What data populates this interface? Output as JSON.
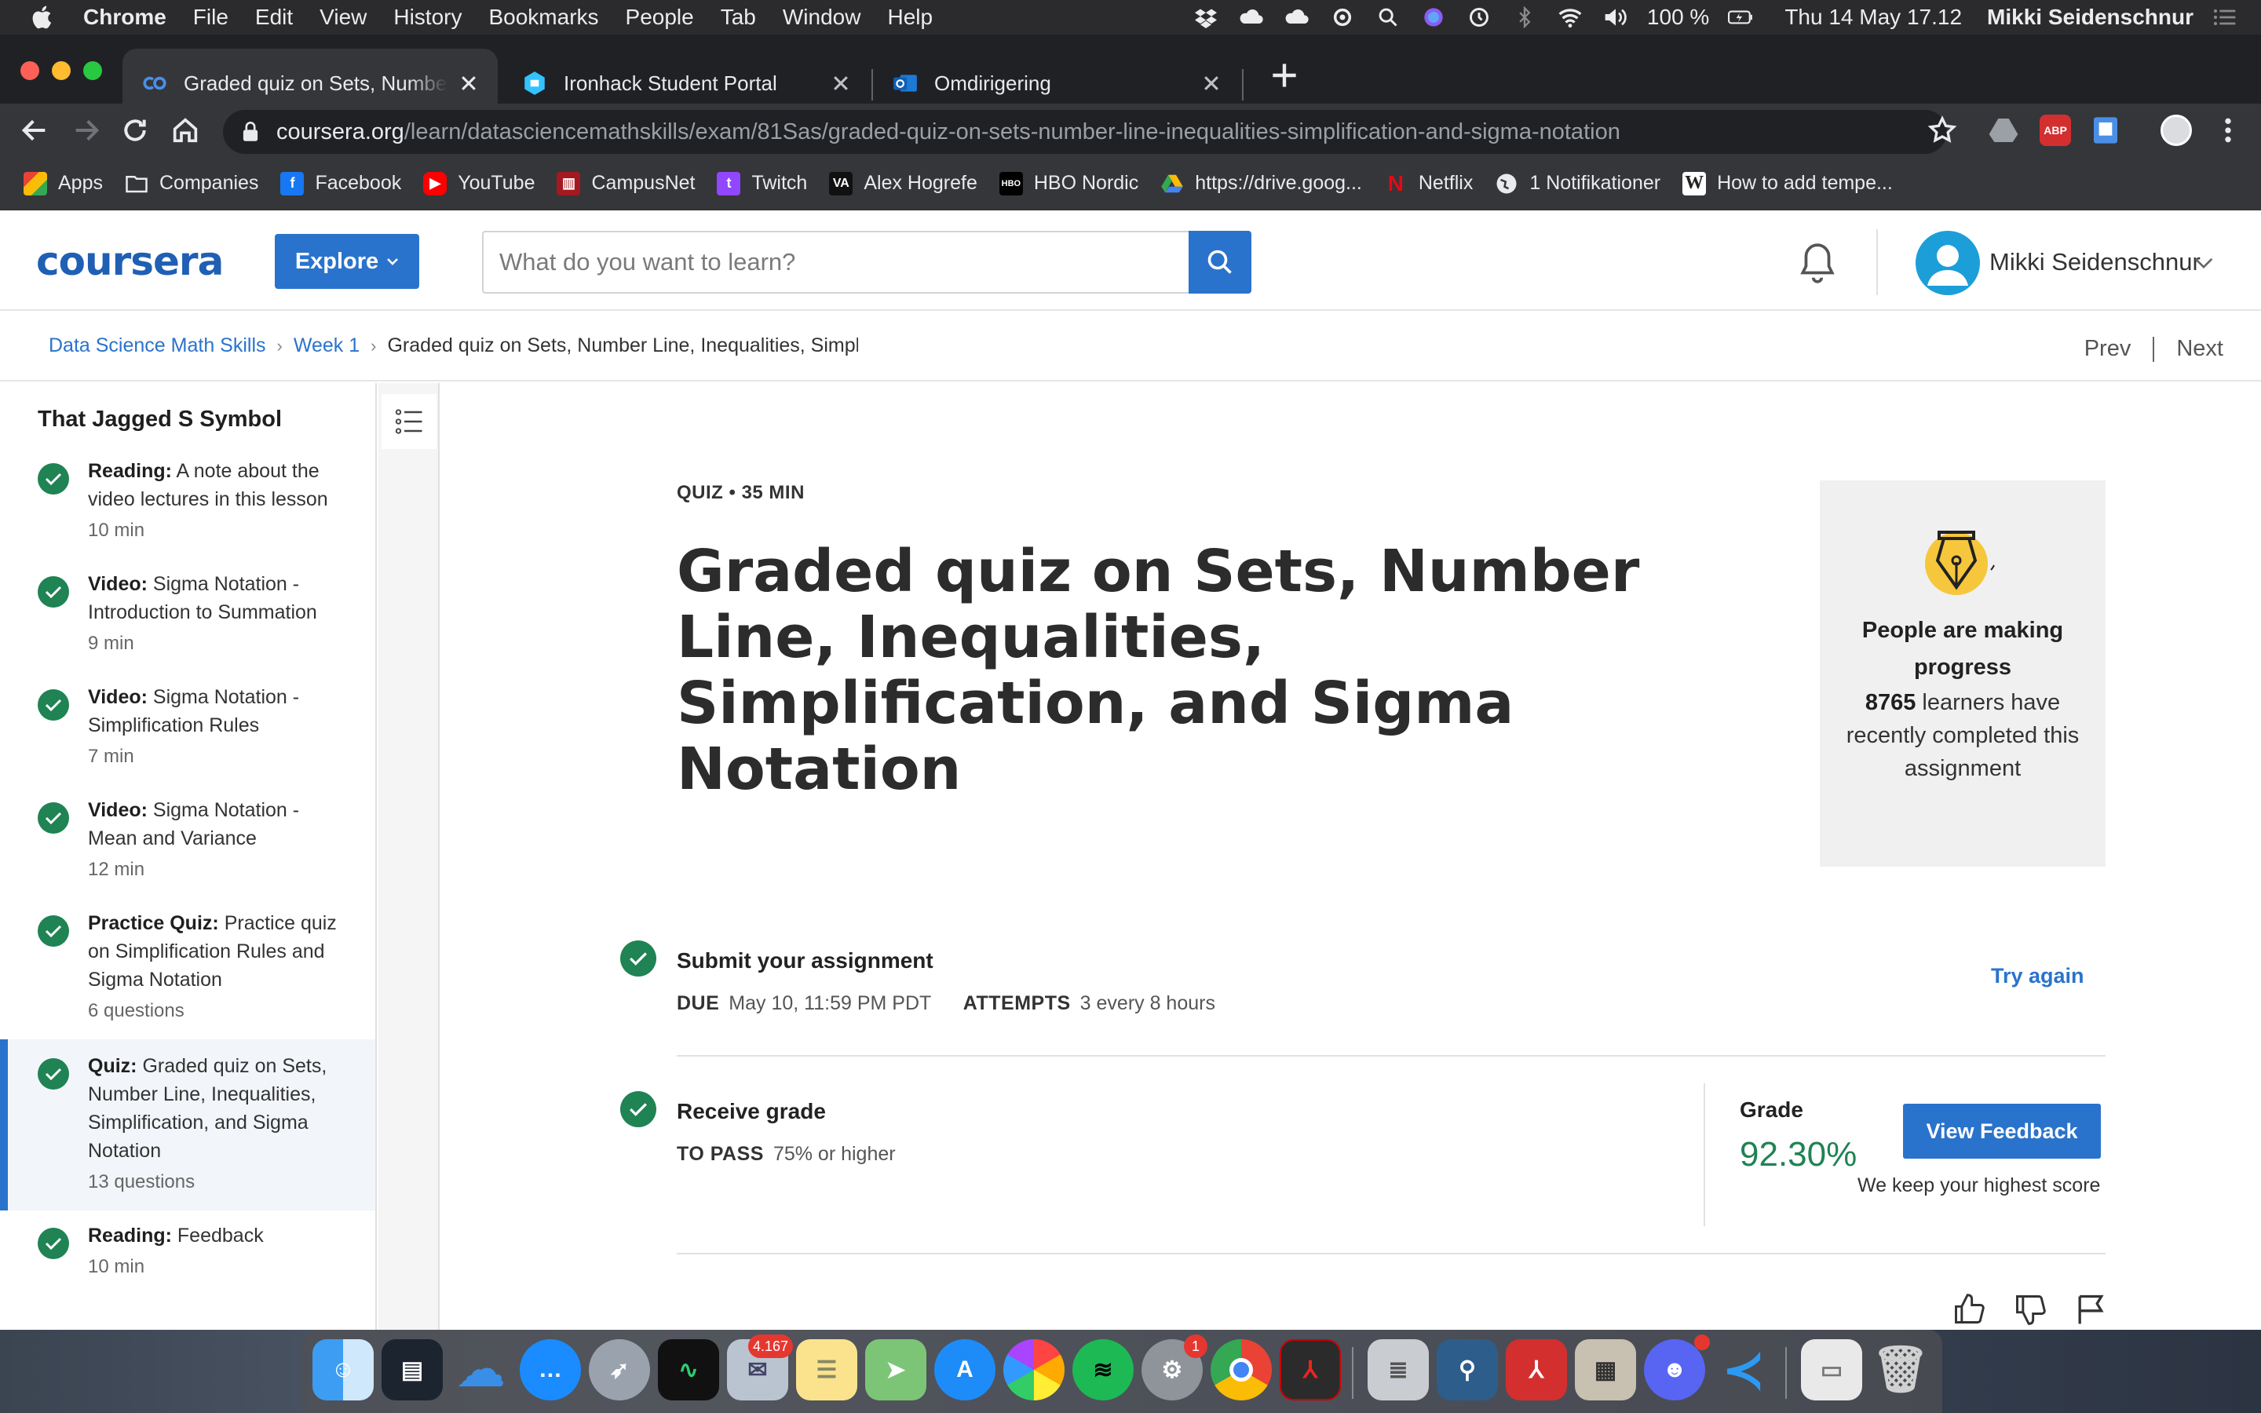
{
  "menubar": {
    "app": "Chrome",
    "items": [
      "File",
      "Edit",
      "View",
      "History",
      "Bookmarks",
      "People",
      "Tab",
      "Window",
      "Help"
    ],
    "battery": "100 %",
    "datetime": "Thu 14 May  17.12",
    "user": "Mikki Seidenschnur"
  },
  "tabs": [
    {
      "title": "Graded quiz on Sets, Number Line, Inequalities",
      "active": true
    },
    {
      "title": "Ironhack Student Portal",
      "active": false
    },
    {
      "title": "Omdirigering",
      "active": false
    }
  ],
  "address": {
    "host": "coursera.org",
    "path": "/learn/datasciencemathskills/exam/81Sas/graded-quiz-on-sets-number-line-inequalities-simplification-and-sigma-notation"
  },
  "bookmarks": [
    "Apps",
    "Companies",
    "Facebook",
    "YouTube",
    "CampusNet",
    "Twitch",
    "Alex Hogrefe",
    "HBO Nordic",
    "https://drive.goog...",
    "Netflix",
    "1 Notifikationer",
    "How to add tempe..."
  ],
  "header": {
    "logo": "coursera",
    "explore": "Explore",
    "search_placeholder": "What do you want to learn?",
    "user": "Mikki Seidenschnur"
  },
  "breadcrumb": {
    "course": "Data Science Math Skills",
    "week": "Week 1",
    "current": "Graded quiz on Sets, Number Line, Inequalities, Simplification"
  },
  "nav": {
    "prev": "Prev",
    "next": "Next"
  },
  "sidebar": {
    "title": "That Jagged S Symbol",
    "lessons": [
      {
        "type": "Reading:",
        "name": "A note about the video lectures in this lesson",
        "duration": "10 min"
      },
      {
        "type": "Video:",
        "name": "Sigma Notation - Introduction to Summation",
        "duration": "9 min"
      },
      {
        "type": "Video:",
        "name": "Sigma Notation - Simplification Rules",
        "duration": "7 min"
      },
      {
        "type": "Video:",
        "name": "Sigma Notation - Mean and Variance",
        "duration": "12 min"
      },
      {
        "type": "Practice Quiz:",
        "name": "Practice quiz on Simplification Rules and Sigma Notation",
        "duration": "6 questions"
      },
      {
        "type": "Quiz:",
        "name": "Graded quiz on Sets, Number Line, Inequalities, Simplification, and Sigma Notation",
        "duration": "13 questions"
      },
      {
        "type": "Reading:",
        "name": "Feedback",
        "duration": "10 min"
      }
    ]
  },
  "quiz": {
    "meta": "QUIZ • 35 MIN",
    "title": "Graded quiz on Sets, Number Line, Inequalities, Simplification, and Sigma Notation"
  },
  "progress_card": {
    "title": "People are making progress",
    "count": "8765",
    "text": "learners have recently completed this assignment"
  },
  "submit": {
    "title": "Submit your assignment",
    "due_label": "DUE",
    "due_value": "May 10, 11:59 PM PDT",
    "attempts_label": "ATTEMPTS",
    "attempts_value": "3 every 8 hours",
    "try_again": "Try again"
  },
  "receive": {
    "title": "Receive grade",
    "pass_label": "TO PASS",
    "pass_value": "75% or higher",
    "grade_label": "Grade",
    "grade_value": "92.30%",
    "view_feedback": "View Feedback",
    "note": "We keep your highest score"
  },
  "dock": {
    "badges": {
      "mail": "4.167",
      "system_prefs": "1"
    }
  },
  "colors": {
    "coursera_blue": "#2a73cc",
    "success_green": "#1f8354",
    "chrome_dark": "#35363a"
  }
}
